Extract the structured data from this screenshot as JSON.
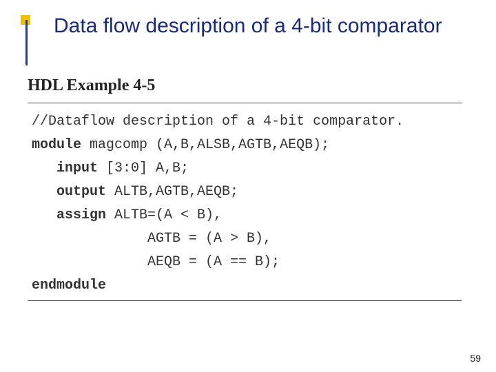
{
  "slide": {
    "title": "Data flow description of a 4-bit comparator",
    "page_number": "59"
  },
  "example": {
    "header": "HDL Example 4-5",
    "lines": [
      {
        "indent": 0,
        "bold": false,
        "prefix": "",
        "text": "//Dataflow description of a 4-bit comparator."
      },
      {
        "indent": 0,
        "bold": true,
        "prefix": "module",
        "text": " magcomp (A,B,ALSB,AGTB,AEQB);"
      },
      {
        "indent": 1,
        "bold": true,
        "prefix": "input",
        "text": " [3:0] A,B;"
      },
      {
        "indent": 1,
        "bold": true,
        "prefix": "output",
        "text": " ALTB,AGTB,AEQB;"
      },
      {
        "indent": 1,
        "bold": true,
        "prefix": "assign",
        "text": " ALTB=(A < B),"
      },
      {
        "indent": 3,
        "bold": false,
        "prefix": "",
        "text": "     AGTB = (A > B),"
      },
      {
        "indent": 3,
        "bold": false,
        "prefix": "",
        "text": "     AEQB = (A == B);"
      },
      {
        "indent": 0,
        "bold": true,
        "prefix": "endmodule",
        "text": ""
      }
    ]
  }
}
